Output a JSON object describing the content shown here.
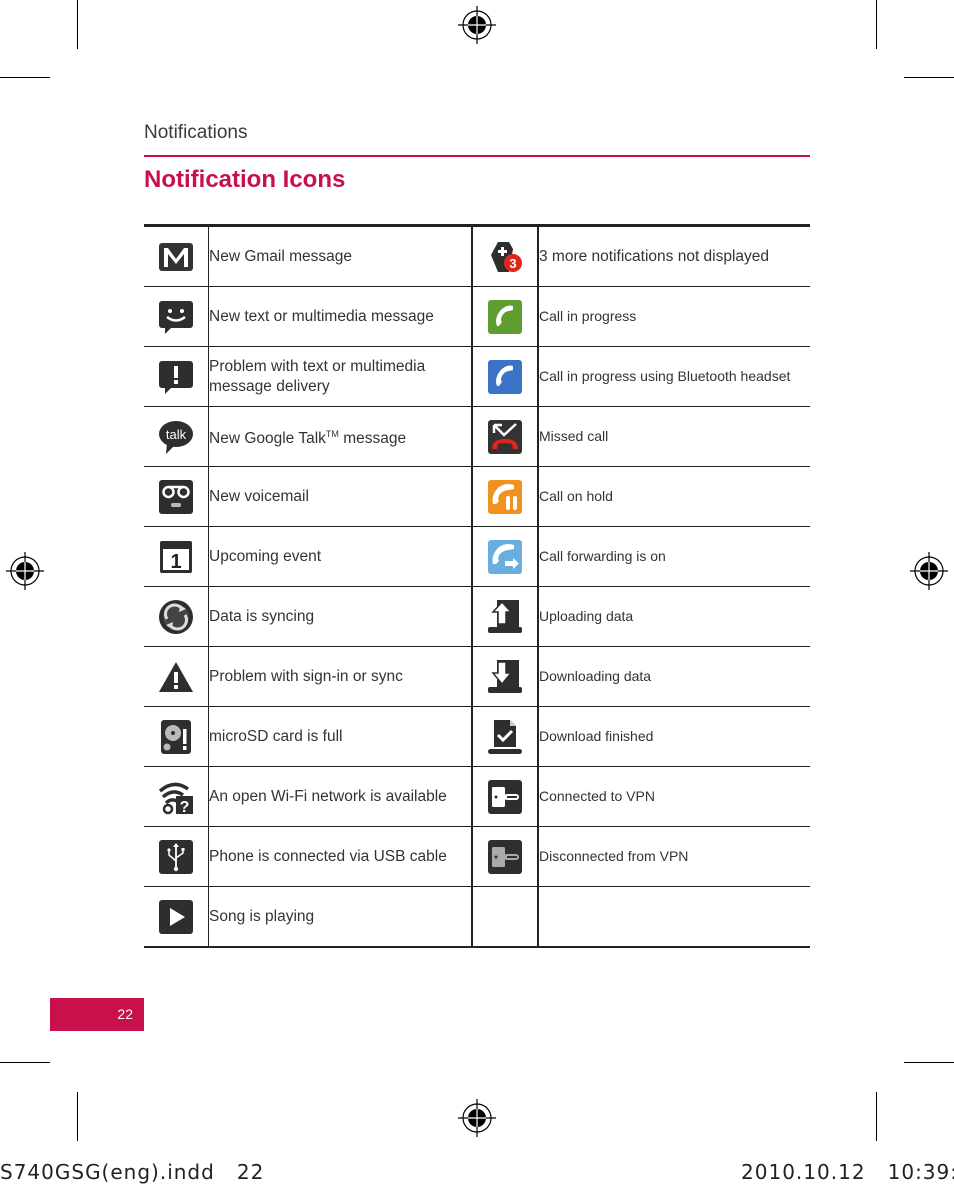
{
  "header": {
    "section": "Notifications",
    "title": "Notification Icons"
  },
  "colors": {
    "accent": "#c8104a",
    "call_green": "#5e9e2e",
    "call_blue": "#3b73c6",
    "call_orange": "#f0931e",
    "call_forward_blue": "#6aaee0",
    "missed_red": "#e1251b",
    "badge_red": "#e1251b"
  },
  "rows": [
    {
      "left": {
        "icon": "gmail-icon",
        "label": "New Gmail message"
      },
      "right": {
        "icon": "more-notifications-icon",
        "label": "3 more notifications not displayed",
        "badge": "3"
      }
    },
    {
      "left": {
        "icon": "text-message-icon",
        "label": "New text or multimedia message"
      },
      "right": {
        "icon": "call-in-progress-icon",
        "label": "Call in progress"
      }
    },
    {
      "left": {
        "icon": "message-error-icon",
        "label": "Problem with text or multimedia message delivery"
      },
      "right": {
        "icon": "bluetooth-call-icon",
        "label": "Call in progress using Bluetooth headset"
      }
    },
    {
      "left": {
        "icon": "google-talk-icon",
        "label": "New Google Talk",
        "label_sup": "TM",
        "label_after": " message",
        "icon_text": "talk"
      },
      "right": {
        "icon": "missed-call-icon",
        "label": "Missed call"
      }
    },
    {
      "left": {
        "icon": "voicemail-icon",
        "label": "New voicemail"
      },
      "right": {
        "icon": "call-on-hold-icon",
        "label": "Call on hold"
      }
    },
    {
      "left": {
        "icon": "calendar-icon",
        "label": "Upcoming event",
        "icon_text": "1"
      },
      "right": {
        "icon": "call-forwarding-icon",
        "label": "Call forwarding is on"
      }
    },
    {
      "left": {
        "icon": "sync-icon",
        "label": "Data is syncing"
      },
      "right": {
        "icon": "upload-icon",
        "label": "Uploading data"
      }
    },
    {
      "left": {
        "icon": "warning-icon",
        "label": "Problem with sign-in or sync"
      },
      "right": {
        "icon": "download-icon",
        "label": "Downloading data"
      }
    },
    {
      "left": {
        "icon": "sd-card-full-icon",
        "label": "microSD card is full"
      },
      "right": {
        "icon": "download-finished-icon",
        "label": "Download finished"
      }
    },
    {
      "left": {
        "icon": "open-wifi-icon",
        "label": "An open Wi-Fi network is available"
      },
      "right": {
        "icon": "vpn-connected-icon",
        "label": "Connected to VPN"
      }
    },
    {
      "left": {
        "icon": "usb-icon",
        "label": "Phone is connected via USB cable"
      },
      "right": {
        "icon": "vpn-disconnected-icon",
        "label": "Disconnected from VPN"
      }
    },
    {
      "left": {
        "icon": "play-icon",
        "label": "Song is playing"
      },
      "right": {
        "icon": "",
        "label": ""
      }
    }
  ],
  "footer": {
    "page_number": "22",
    "slug_file": "S740GSG(eng).indd   22",
    "slug_date": "2010.10.12   10:39:"
  }
}
